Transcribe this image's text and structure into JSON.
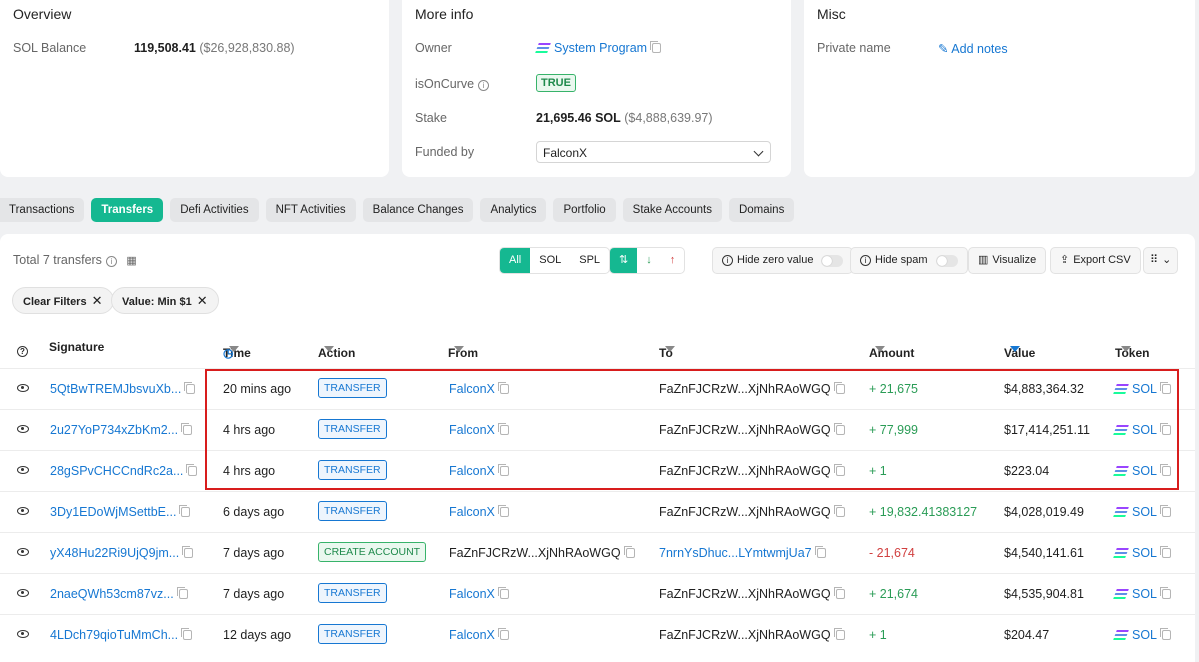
{
  "overview": {
    "title": "Overview",
    "sol_balance_label": "SOL Balance",
    "sol_balance_value": "119,508.41",
    "sol_balance_usd": "($26,928,830.88)"
  },
  "more_info": {
    "title": "More info",
    "owner_label": "Owner",
    "owner_value": "System Program",
    "oncurve_label": "isOnCurve",
    "oncurve_value": "TRUE",
    "stake_label": "Stake",
    "stake_value": "21,695.46 SOL",
    "stake_usd": "($4,888,639.97)",
    "funded_label": "Funded by",
    "funded_value": "FalconX"
  },
  "misc": {
    "title": "Misc",
    "private_name_label": "Private name",
    "add_notes": "Add notes"
  },
  "tabs": [
    "Transactions",
    "Transfers",
    "Defi Activities",
    "NFT Activities",
    "Balance Changes",
    "Analytics",
    "Portfolio",
    "Stake Accounts",
    "Domains"
  ],
  "active_tab": "Transfers",
  "toolbar": {
    "total": "Total 7 transfers",
    "filter_all": "All",
    "filter_sol": "SOL",
    "filter_spl": "SPL",
    "hide_zero": "Hide zero value",
    "hide_spam": "Hide spam",
    "visualize": "Visualize",
    "export": "Export CSV"
  },
  "chips": {
    "clear": "Clear Filters",
    "value": "Value: Min $1"
  },
  "columns": {
    "signature": "Signature",
    "time": "Time",
    "action": "Action",
    "from": "From",
    "to": "To",
    "amount": "Amount",
    "value": "Value",
    "token": "Token"
  },
  "rows": [
    {
      "signature": "5QtBwTREMJbsvuXb...",
      "time": "20 mins ago",
      "action": "TRANSFER",
      "from": "FalconX",
      "to": "FaZnFJCRzW...XjNhRAoWGQ",
      "amount": "+ 21,675",
      "value": "$4,883,364.32",
      "token": "SOL"
    },
    {
      "signature": "2u27YoP734xZbKm2...",
      "time": "4 hrs ago",
      "action": "TRANSFER",
      "from": "FalconX",
      "to": "FaZnFJCRzW...XjNhRAoWGQ",
      "amount": "+ 77,999",
      "value": "$17,414,251.11",
      "token": "SOL"
    },
    {
      "signature": "28gSPvCHCCndRc2a...",
      "time": "4 hrs ago",
      "action": "TRANSFER",
      "from": "FalconX",
      "to": "FaZnFJCRzW...XjNhRAoWGQ",
      "amount": "+ 1",
      "value": "$223.04",
      "token": "SOL"
    },
    {
      "signature": "3Dy1EDoWjMSettbE...",
      "time": "6 days ago",
      "action": "TRANSFER",
      "from": "FalconX",
      "to": "FaZnFJCRzW...XjNhRAoWGQ",
      "amount": "+ 19,832.41383127",
      "value": "$4,028,019.49",
      "token": "SOL"
    },
    {
      "signature": "yX48Hu22Ri9UjQ9jm...",
      "time": "7 days ago",
      "action": "CREATE ACCOUNT",
      "from": "FaZnFJCRzW...XjNhRAoWGQ",
      "to": "7nrnYsDhuc...LYmtwmjUa7",
      "amount": "- 21,674",
      "value": "$4,540,141.61",
      "token": "SOL"
    },
    {
      "signature": "2naeQWh53cm87vz...",
      "time": "7 days ago",
      "action": "TRANSFER",
      "from": "FalconX",
      "to": "FaZnFJCRzW...XjNhRAoWGQ",
      "amount": "+ 21,674",
      "value": "$4,535,904.81",
      "token": "SOL"
    },
    {
      "signature": "4LDch79qioTuMmCh...",
      "time": "12 days ago",
      "action": "TRANSFER",
      "from": "FalconX",
      "to": "FaZnFJCRzW...XjNhRAoWGQ",
      "amount": "+ 1",
      "value": "$204.47",
      "token": "SOL"
    }
  ],
  "colors": {
    "accent": "#15b891",
    "link": "#1677d2",
    "positive": "#2a9c56",
    "negative": "#d13f3f",
    "highlight": "#d81d1d"
  }
}
